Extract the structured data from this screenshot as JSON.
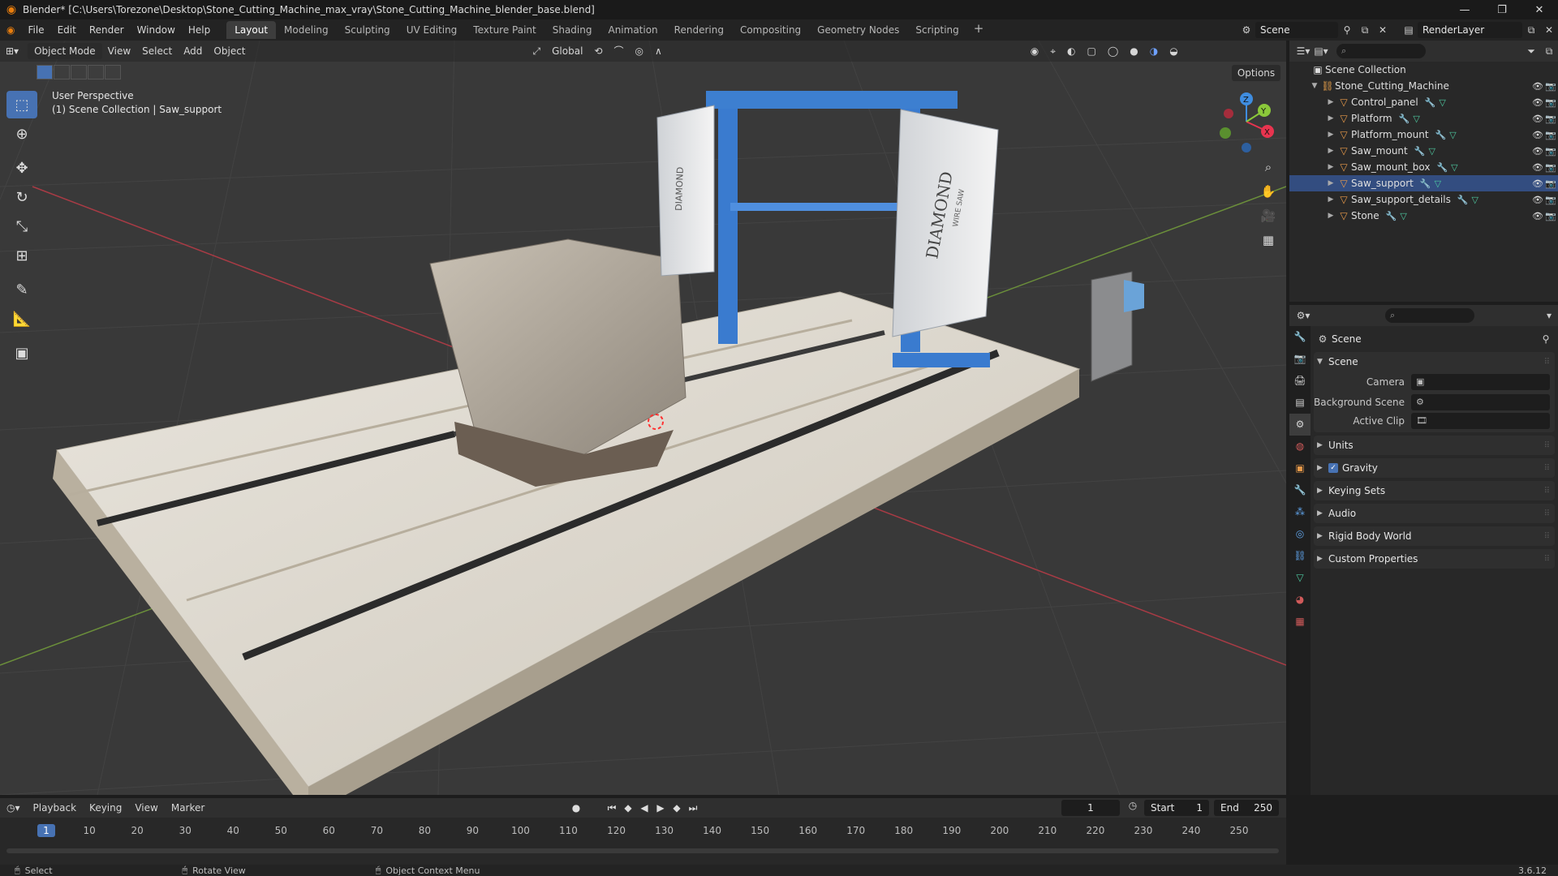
{
  "window": {
    "title": "Blender* [C:\\Users\\Torezone\\Desktop\\Stone_Cutting_Machine_max_vray\\Stone_Cutting_Machine_blender_base.blend]",
    "controls": [
      "—",
      "❐",
      "✕"
    ]
  },
  "menu": [
    "File",
    "Edit",
    "Render",
    "Window",
    "Help"
  ],
  "workspaces": [
    "Layout",
    "Modeling",
    "Sculpting",
    "UV Editing",
    "Texture Paint",
    "Shading",
    "Animation",
    "Rendering",
    "Compositing",
    "Geometry Nodes",
    "Scripting"
  ],
  "active_workspace": "Layout",
  "scene_selector": "Scene",
  "view_layer": "RenderLayer",
  "viewport": {
    "mode": "Object Mode",
    "menus": [
      "View",
      "Select",
      "Add",
      "Object"
    ],
    "transform_orientation": "Global",
    "options_label": "Options",
    "perspective": "User Perspective",
    "context": "(1) Scene Collection | Saw_support",
    "gizmo_axes": [
      "Z",
      "Y",
      "X"
    ],
    "colors": {
      "x": "#e8344f",
      "y": "#8bc83a",
      "z": "#3f8de0",
      "grid": "#444444",
      "bg": "#393939"
    }
  },
  "model_labels": [
    "DIAMOND",
    "WIRE SAW"
  ],
  "outliner": {
    "root": "Scene Collection",
    "collection": "Stone_Cutting_Machine",
    "objects": [
      {
        "name": "Control_panel",
        "selected": false
      },
      {
        "name": "Platform",
        "selected": false
      },
      {
        "name": "Platform_mount",
        "selected": false
      },
      {
        "name": "Saw_mount",
        "selected": false
      },
      {
        "name": "Saw_mount_box",
        "selected": false
      },
      {
        "name": "Saw_support",
        "selected": true
      },
      {
        "name": "Saw_support_details",
        "selected": false
      },
      {
        "name": "Stone",
        "selected": false
      }
    ]
  },
  "properties": {
    "context": "Scene",
    "panel_title": "Scene",
    "fields": [
      {
        "label": "Camera"
      },
      {
        "label": "Background Scene"
      },
      {
        "label": "Active Clip"
      }
    ],
    "subpanels": [
      "Units",
      "Gravity",
      "Keying Sets",
      "Audio",
      "Rigid Body World",
      "Custom Properties"
    ],
    "gravity_checked": true
  },
  "timeline": {
    "menus": [
      "Playback",
      "Keying",
      "View",
      "Marker"
    ],
    "current_frame": "1",
    "start_label": "Start",
    "start": "1",
    "end_label": "End",
    "end": "250",
    "ticks": [
      "1",
      "10",
      "20",
      "30",
      "40",
      "50",
      "60",
      "70",
      "80",
      "90",
      "100",
      "110",
      "120",
      "130",
      "140",
      "150",
      "160",
      "170",
      "180",
      "190",
      "200",
      "210",
      "220",
      "230",
      "240",
      "250"
    ]
  },
  "statusbar": {
    "items": [
      "Select",
      "Rotate View",
      "Object Context Menu"
    ],
    "version": "3.6.12"
  }
}
